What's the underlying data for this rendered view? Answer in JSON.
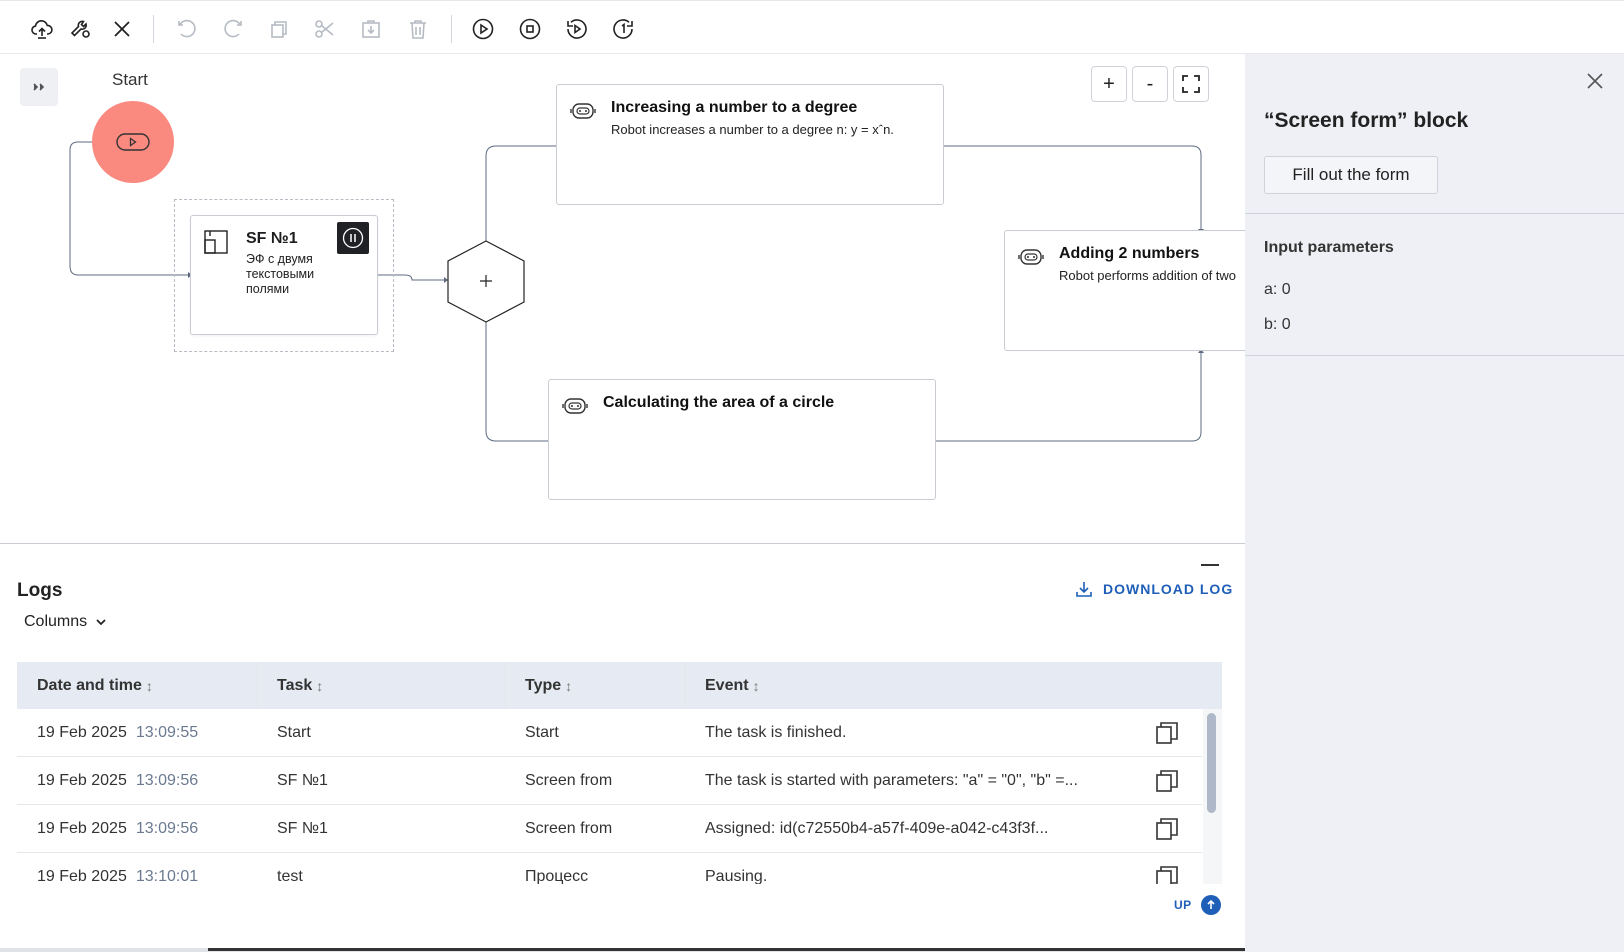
{
  "toolbar": {
    "items": [
      "cloud-upload-icon",
      "wrench-settings-icon",
      "close-icon",
      "undo-icon",
      "redo-icon",
      "copy-icon",
      "cut-icon",
      "paste-icon",
      "delete-icon",
      "play-icon",
      "stop-icon",
      "replay-icon",
      "run-once-icon"
    ]
  },
  "canvas": {
    "start_label": "Start",
    "nodes": {
      "power": {
        "title": "Increasing a number to a degree",
        "desc": "Robot increases a number to a degree n: y = xˆn."
      },
      "add": {
        "title": "Adding 2 numbers",
        "desc": "Robot performs addition of two"
      },
      "circle": {
        "title": "Calculating the area of a circle"
      },
      "sf": {
        "title": "SF №1",
        "desc": "ЭФ с двумя текстовыми полями"
      }
    },
    "zoom_in": "+",
    "zoom_out": "-"
  },
  "side": {
    "title": "“Screen form” block",
    "fill_button": "Fill out the form",
    "input_params_title": "Input parameters",
    "params": [
      "a: 0",
      "b: 0"
    ]
  },
  "logs": {
    "title": "Logs",
    "columns_label": "Columns",
    "download_label": "DOWNLOAD LOG",
    "up_label": "UP",
    "headers": [
      "Date and time",
      "Task",
      "Type",
      "Event"
    ],
    "rows": [
      {
        "date": "19 Feb 2025",
        "time": "13:09:55",
        "task": "Start",
        "type": "Start",
        "event": "The task is finished."
      },
      {
        "date": "19 Feb 2025",
        "time": "13:09:56",
        "task": "SF №1",
        "type": "Screen from",
        "event": "The task is started with parameters: \"a\" = \"0\", \"b\" =..."
      },
      {
        "date": "19 Feb 2025",
        "time": "13:09:56",
        "task": "SF №1",
        "type": "Screen from",
        "event": "Assigned: id(c72550b4-a57f-409e-a042-c43f3f..."
      },
      {
        "date": "19 Feb 2025",
        "time": "13:10:01",
        "task": "test",
        "type": "Процесс",
        "event": "Pausing."
      }
    ]
  }
}
